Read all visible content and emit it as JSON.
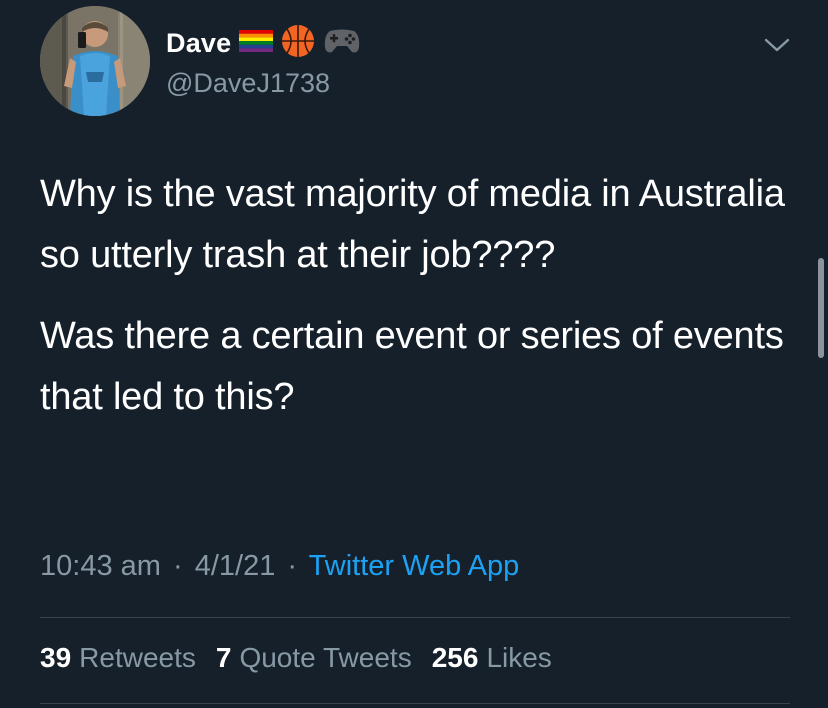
{
  "user": {
    "display_name": "Dave",
    "emoji_icons": [
      "rainbow-flag-icon",
      "basketball-icon",
      "game-controller-icon"
    ],
    "handle": "@DaveJ1738"
  },
  "tweet": {
    "paragraphs": [
      "Why is the vast majority of media in Australia so utterly trash at their job????",
      "Was there a certain event or series of events that led to this?"
    ],
    "time": "10:43 am",
    "date": "4/1/21",
    "separator": "·",
    "source": "Twitter Web App"
  },
  "stats": {
    "retweets_count": "39",
    "retweets_label": "Retweets",
    "quotes_count": "7",
    "quotes_label": "Quote Tweets",
    "likes_count": "256",
    "likes_label": "Likes"
  },
  "colors": {
    "background": "#15202b",
    "text_primary": "#ffffff",
    "text_secondary": "#8899a6",
    "link": "#1da1f2",
    "divider": "#38444d"
  }
}
